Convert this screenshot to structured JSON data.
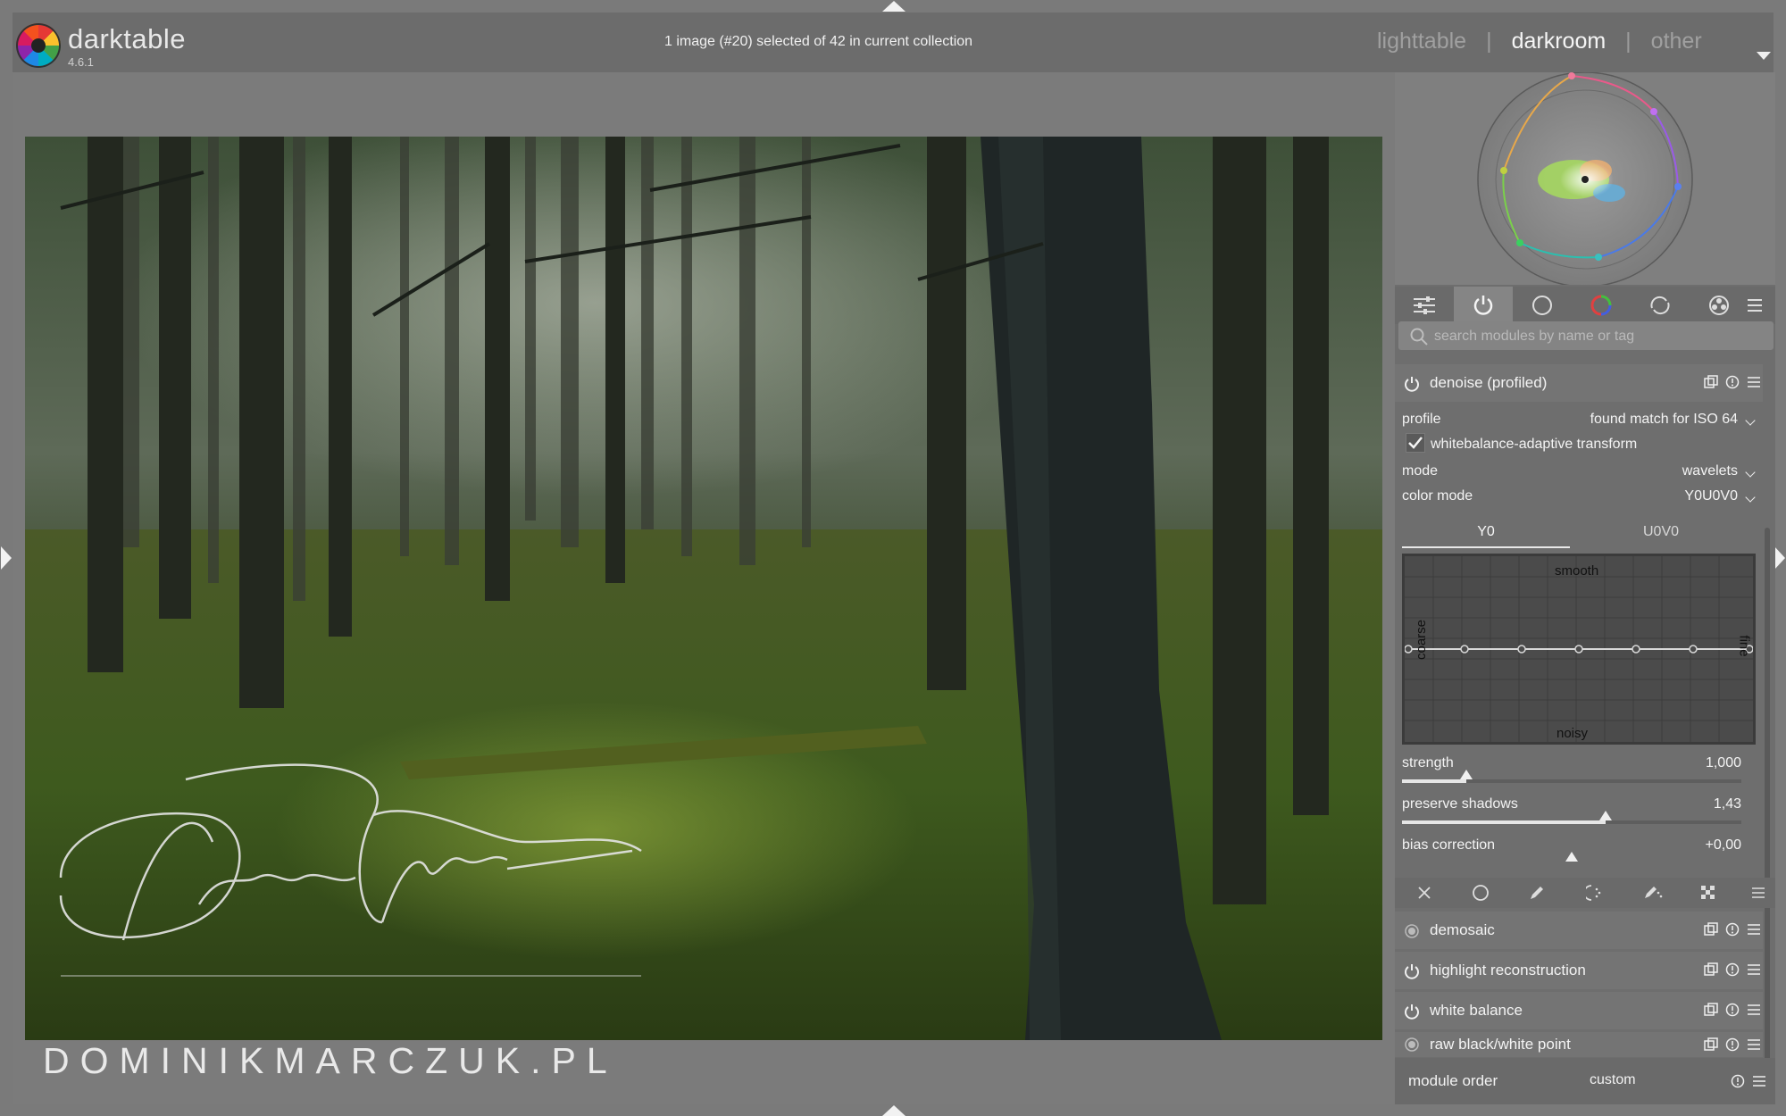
{
  "app": {
    "name": "darktable",
    "version": "4.6.1"
  },
  "header": {
    "collection_status": "1 image (#20) selected of 42 in current collection",
    "views": {
      "lighttable": "lighttable",
      "darkroom": "darkroom",
      "other": "other",
      "separator": "|"
    },
    "active_view": "darkroom"
  },
  "image": {
    "watermark_signature": "Dominik Marczuk",
    "watermark_site": "DOMINIKMARCZUK.PL"
  },
  "module_groups": [
    {
      "icon": "quick-access-sliders-icon"
    },
    {
      "icon": "active-modules-power-icon",
      "active": true
    },
    {
      "icon": "base-circle-icon"
    },
    {
      "icon": "color-ring-icon"
    },
    {
      "icon": "correct-icon"
    },
    {
      "icon": "effect-icon"
    },
    {
      "icon": "presets-menu-icon"
    }
  ],
  "search": {
    "placeholder": "search modules by name or tag"
  },
  "denoise": {
    "title": "denoise (profiled)",
    "profile_label": "profile",
    "profile_value": "found match for ISO 64",
    "checkbox_label": "whitebalance-adaptive transform",
    "checkbox_checked": true,
    "mode_label": "mode",
    "mode_value": "wavelets",
    "color_mode_label": "color mode",
    "color_mode_value": "Y0U0V0",
    "tabs": [
      "Y0",
      "U0V0"
    ],
    "active_tab": "Y0",
    "curve_labels": {
      "top": "smooth",
      "bottom": "noisy",
      "left": "coarse",
      "right": "fine"
    },
    "strength": {
      "label": "strength",
      "value": "1,000",
      "fill": 0.19
    },
    "preserve_shadows": {
      "label": "preserve shadows",
      "value": "1,43",
      "fill": 0.6
    },
    "bias_correction": {
      "label": "bias correction",
      "value": "+0,00",
      "fill": 0.5
    }
  },
  "modules": [
    {
      "name": "demosaic",
      "power": "always-on"
    },
    {
      "name": "highlight reconstruction",
      "power": "on"
    },
    {
      "name": "white balance",
      "power": "on"
    },
    {
      "name": "raw black/white point",
      "power": "always-on"
    }
  ],
  "module_order": {
    "label": "module order",
    "value": "custom"
  },
  "colors": {
    "panel_bg": "#6e6e6e",
    "header_bg": "#6c6c6c",
    "text": "#f3f3f3",
    "accent": "#e6e6e6"
  }
}
